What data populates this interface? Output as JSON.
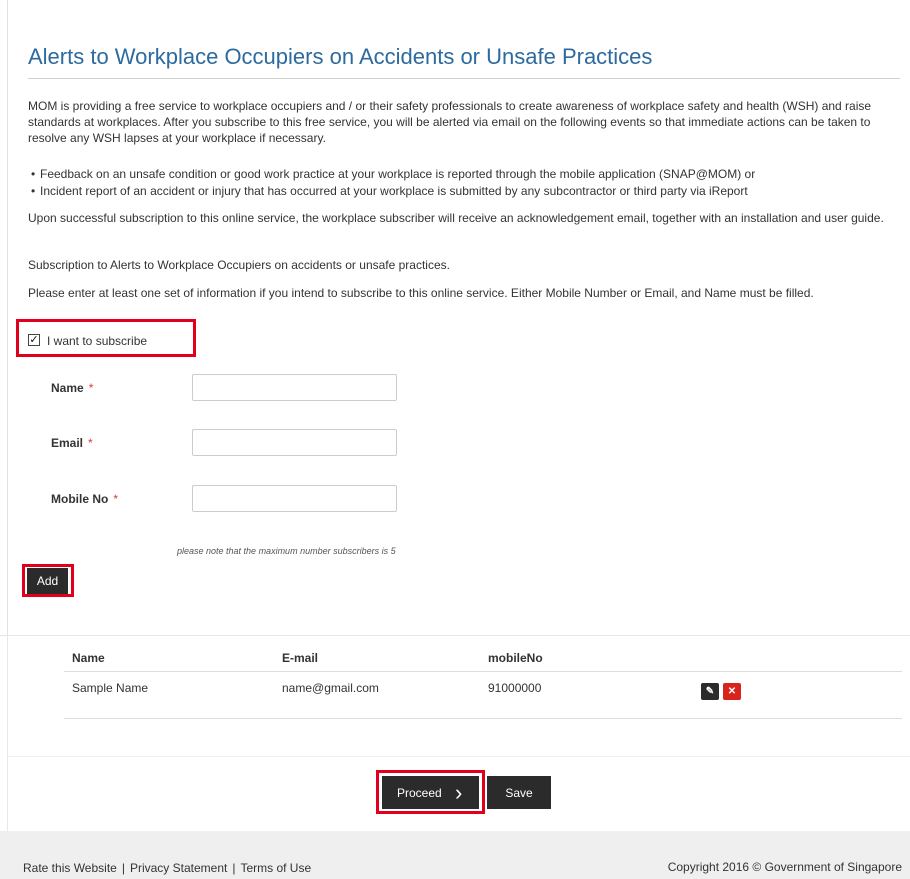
{
  "page": {
    "title": "Alerts to Workplace Occupiers on Accidents or Unsafe Practices",
    "intro": "MOM is providing a free service to workplace occupiers and / or their safety professionals to create awareness of workplace safety and health (WSH) and raise standards at workplaces. After you subscribe to this free service, you will be alerted via email on the following events so that immediate actions can be taken to resolve any WSH lapses at your workplace if necessary.",
    "bullets": [
      "Feedback on an unsafe condition or good work practice at your workplace is reported through the mobile application (SNAP@MOM) or",
      "Incident report of an accident or injury that has occurred at your workplace is submitted by any subcontractor or third party via iReport"
    ],
    "para_ack": "Upon successful subscription to this online service, the workplace subscriber will receive an acknowledgement email, together with an installation and user guide.",
    "para_sub": "Subscription to Alerts to Workplace Occupiers on accidents or unsafe practices.",
    "para_enter": "Please enter at least one set of information if you intend to subscribe to this online service. Either Mobile Number or Email, and Name must be filled."
  },
  "form": {
    "subscribe_label": "I want to subscribe",
    "subscribe_checked": true,
    "name_label": "Name",
    "email_label": "Email",
    "mobile_label": "Mobile No",
    "required_mark": "*",
    "name_value": "",
    "email_value": "",
    "mobile_value": "",
    "note": "please note that the maximum number subscribers is 5",
    "add_label": "Add"
  },
  "table": {
    "headers": [
      "Name",
      "E-mail",
      "mobileNo"
    ],
    "rows": [
      {
        "name": "Sample Name",
        "email": "name@gmail.com",
        "mobile": "91000000"
      }
    ]
  },
  "actions": {
    "proceed_label": "Proceed",
    "proceed_icon": "chevron-right-icon",
    "save_label": "Save"
  },
  "footer": {
    "links": [
      "Rate this Website",
      "Privacy Statement",
      "Terms of Use"
    ],
    "separator": "|",
    "copyright": "Copyright 2016 © Government of Singapore"
  },
  "colors": {
    "title": "#2c6aa0",
    "highlight": "#e0001b",
    "button": "#2b2b2b",
    "delete": "#d9231d"
  }
}
